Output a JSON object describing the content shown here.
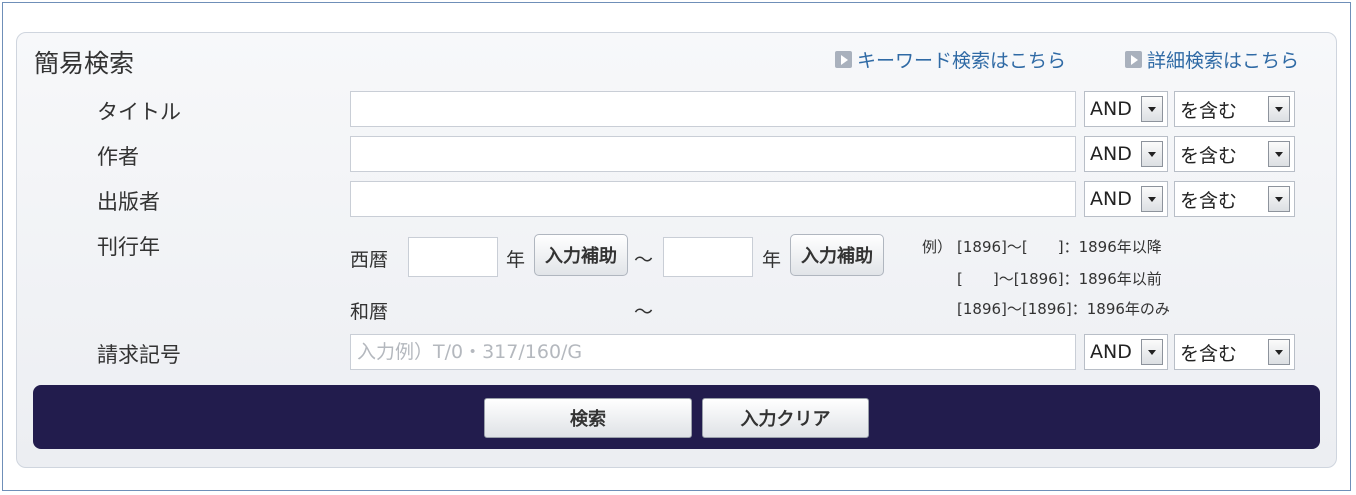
{
  "panel": {
    "title": "簡易検索",
    "links": {
      "keyword": "キーワード検索はこちら",
      "detail": "詳細検索はこちら"
    }
  },
  "fields": {
    "title": {
      "label": "タイトル",
      "value": "",
      "op": "AND",
      "match": "を含む"
    },
    "author": {
      "label": "作者",
      "value": "",
      "op": "AND",
      "match": "を含む"
    },
    "publisher": {
      "label": "出版者",
      "value": "",
      "op": "AND",
      "match": "を含む"
    },
    "pubyear": {
      "label": "刊行年",
      "western_label": "西暦",
      "japanese_label": "和暦",
      "year_unit": "年",
      "assist_label": "入力補助",
      "tilde": "～",
      "from_value": "",
      "to_value": ""
    },
    "callnumber": {
      "label": "請求記号",
      "value": "",
      "placeholder": "入力例）T/0・317/160/G",
      "op": "AND",
      "match": "を含む"
    }
  },
  "examples": {
    "prefix": "例）",
    "line1": "[1896]～[　　]：1896年以降",
    "line2": "[　　]～[1896]：1896年以前",
    "line3": "[1896]～[1896]：1896年のみ"
  },
  "actions": {
    "search": "検索",
    "clear": "入力クリア"
  },
  "colors": {
    "action_bar": "#221c4d",
    "link": "#2f6aa5",
    "frame": "#6f8fb8"
  }
}
